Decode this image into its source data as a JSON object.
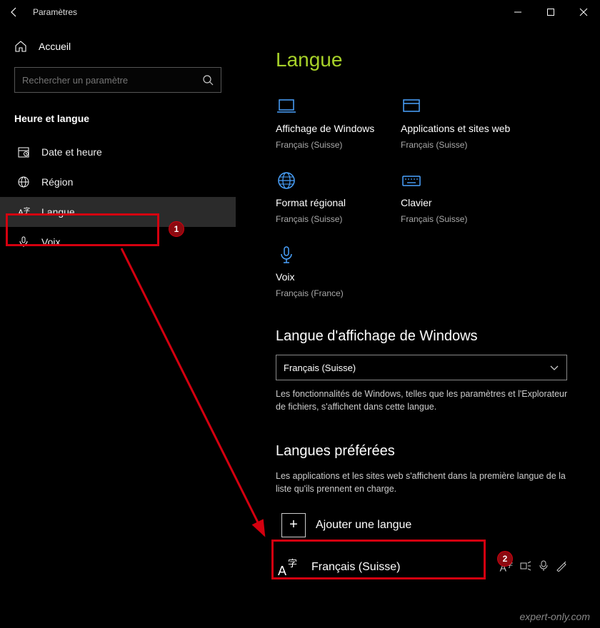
{
  "titlebar": {
    "title": "Paramètres"
  },
  "sidebar": {
    "home_label": "Accueil",
    "search_placeholder": "Rechercher un paramètre",
    "category": "Heure et langue",
    "items": [
      {
        "label": "Date et heure"
      },
      {
        "label": "Région"
      },
      {
        "label": "Langue"
      },
      {
        "label": "Voix"
      }
    ]
  },
  "main": {
    "title": "Langue",
    "tiles": [
      {
        "label": "Affichage de Windows",
        "sub": "Français (Suisse)"
      },
      {
        "label": "Applications et sites web",
        "sub": "Français (Suisse)"
      },
      {
        "label": "Format régional",
        "sub": "Français (Suisse)"
      },
      {
        "label": "Clavier",
        "sub": "Français (Suisse)"
      },
      {
        "label": "Voix",
        "sub": "Français (France)"
      }
    ],
    "display_lang": {
      "title": "Langue d'affichage de Windows",
      "value": "Français (Suisse)",
      "help": "Les fonctionnalités de Windows, telles que les paramètres et l'Explorateur de fichiers, s'affichent dans cette langue."
    },
    "preferred": {
      "title": "Langues préférées",
      "help": "Les applications et les sites web s'affichent dans la première langue de la liste qu'ils prennent en charge.",
      "add_label": "Ajouter une langue",
      "lang0": "Français (Suisse)"
    }
  },
  "annotations": {
    "step1": "1",
    "step2": "2"
  },
  "watermark": "expert-only.com"
}
